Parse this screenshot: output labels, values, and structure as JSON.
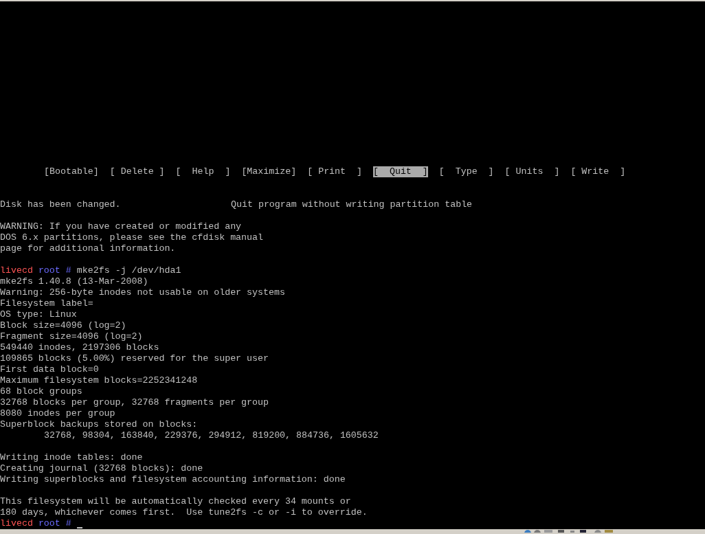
{
  "menu_bar": {
    "items": [
      {
        "label": "[Bootable]",
        "selected": false
      },
      {
        "label": "[ Delete ]",
        "selected": false
      },
      {
        "label": "[  Help  ]",
        "selected": false
      },
      {
        "label": "[Maximize]",
        "selected": false
      },
      {
        "label": "[ Print  ]",
        "selected": false
      },
      {
        "label": "[  Quit  ]",
        "selected": true
      },
      {
        "label": "[  Type  ]",
        "selected": false
      },
      {
        "label": "[ Units  ]",
        "selected": false
      },
      {
        "label": "[ Write  ]",
        "selected": false
      }
    ]
  },
  "status_line": {
    "message": "Disk has been changed.",
    "hint": "Quit program without writing partition table"
  },
  "output_blocks": [
    [
      {
        "kind": "text",
        "text": "WARNING: If you have created or modified any"
      },
      {
        "kind": "text",
        "text": "DOS 6.x partitions, please see the cfdisk manual"
      },
      {
        "kind": "text",
        "text": "page for additional information."
      }
    ],
    [
      {
        "kind": "prompt",
        "host": "livecd",
        "user": "root",
        "sign": "#",
        "command": "mke2fs -j /dev/hda1",
        "cursor": false
      },
      {
        "kind": "text",
        "text": "mke2fs 1.40.8 (13-Mar-2008)"
      },
      {
        "kind": "text",
        "text": "Warning: 256-byte inodes not usable on older systems"
      },
      {
        "kind": "text",
        "text": "Filesystem label="
      },
      {
        "kind": "text",
        "text": "OS type: Linux"
      },
      {
        "kind": "text",
        "text": "Block size=4096 (log=2)"
      },
      {
        "kind": "text",
        "text": "Fragment size=4096 (log=2)"
      },
      {
        "kind": "text",
        "text": "549440 inodes, 2197306 blocks"
      },
      {
        "kind": "text",
        "text": "109865 blocks (5.00%) reserved for the super user"
      },
      {
        "kind": "text",
        "text": "First data block=0"
      },
      {
        "kind": "text",
        "text": "Maximum filesystem blocks=2252341248"
      },
      {
        "kind": "text",
        "text": "68 block groups"
      },
      {
        "kind": "text",
        "text": "32768 blocks per group, 32768 fragments per group"
      },
      {
        "kind": "text",
        "text": "8080 inodes per group"
      },
      {
        "kind": "text",
        "text": "Superblock backups stored on blocks:"
      },
      {
        "kind": "indented",
        "text": "32768, 98304, 163840, 229376, 294912, 819200, 884736, 1605632"
      }
    ],
    [
      {
        "kind": "text",
        "text": "Writing inode tables: done"
      },
      {
        "kind": "text",
        "text": "Creating journal (32768 blocks): done"
      },
      {
        "kind": "text",
        "text": "Writing superblocks and filesystem accounting information: done"
      }
    ],
    [
      {
        "kind": "text",
        "text": "This filesystem will be automatically checked every 34 mounts or"
      },
      {
        "kind": "text",
        "text": "180 days, whichever comes first.  Use tune2fs -c or -i to override."
      },
      {
        "kind": "prompt",
        "host": "livecd",
        "user": "root",
        "sign": "#",
        "cursor": true
      }
    ]
  ]
}
